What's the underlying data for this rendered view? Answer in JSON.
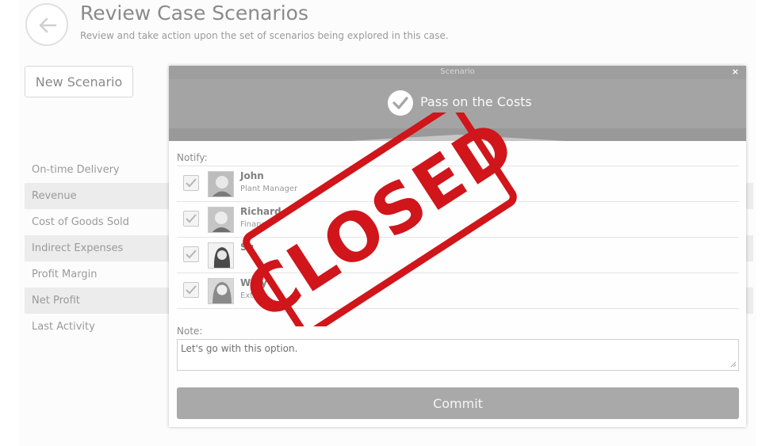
{
  "page": {
    "title": "Review Case Scenarios",
    "subtitle": "Review and take action upon the set of scenarios being explored in this case.",
    "back_icon": "back-arrow-icon",
    "new_scenario_label": "New Scenario"
  },
  "metrics": [
    {
      "label": "On-time Delivery"
    },
    {
      "label": "Revenue"
    },
    {
      "label": "Cost of Goods Sold"
    },
    {
      "label": "Indirect Expenses"
    },
    {
      "label": "Profit Margin"
    },
    {
      "label": "Net Profit"
    },
    {
      "label": "Last Activity"
    }
  ],
  "modal": {
    "window_title": "Scenario",
    "close_label": "×",
    "scenario_name": "Pass on the Costs",
    "notify_label": "Notify:",
    "people": [
      {
        "name": "John",
        "role": "Plant Manager",
        "checked": true
      },
      {
        "name": "Richard",
        "role": "Finance",
        "checked": true
      },
      {
        "name": "Su",
        "role": "",
        "checked": true
      },
      {
        "name": "W   dy",
        "role": "Exte",
        "checked": true
      }
    ],
    "note_label": "Note:",
    "note_value": "Let's go with this option.",
    "commit_label": "Commit"
  },
  "stamp": {
    "text": "CLOSED",
    "color": "#d0151b"
  }
}
